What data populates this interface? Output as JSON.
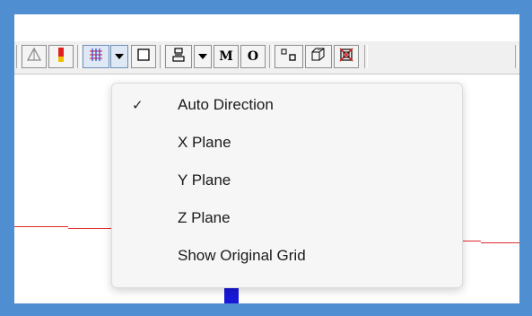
{
  "toolbar": {
    "buttons": [
      {
        "icon": "triangle-nodes-icon"
      },
      {
        "icon": "color-bar-icon"
      },
      {
        "icon": "grid-icon",
        "active": true
      },
      {
        "icon": "chevron-down-icon"
      },
      {
        "icon": "square-outline-icon"
      },
      {
        "icon": "stack-icon"
      },
      {
        "icon": "chevron-down-icon"
      },
      {
        "icon": "letter-m-icon",
        "label": "M"
      },
      {
        "icon": "letter-o-icon",
        "label": "O"
      },
      {
        "icon": "small-squares-icon"
      },
      {
        "icon": "cube-view-icon"
      },
      {
        "icon": "delete-box-icon"
      }
    ]
  },
  "colors": {
    "accent_red": "#e02a2a",
    "accent_blue": "#1818d8",
    "grid_icon_red": "#e8352b",
    "grid_icon_blue": "#2b3de8",
    "menu_background": "#f6f6f6"
  },
  "menu": {
    "items": [
      {
        "label": "Auto Direction",
        "checked": true,
        "check_glyph": "✓"
      },
      {
        "label": "X Plane",
        "checked": false,
        "check_glyph": ""
      },
      {
        "label": "Y Plane",
        "checked": false,
        "check_glyph": ""
      },
      {
        "label": "Z Plane",
        "checked": false,
        "check_glyph": ""
      },
      {
        "label": "Show Original Grid",
        "checked": false,
        "check_glyph": ""
      }
    ]
  }
}
